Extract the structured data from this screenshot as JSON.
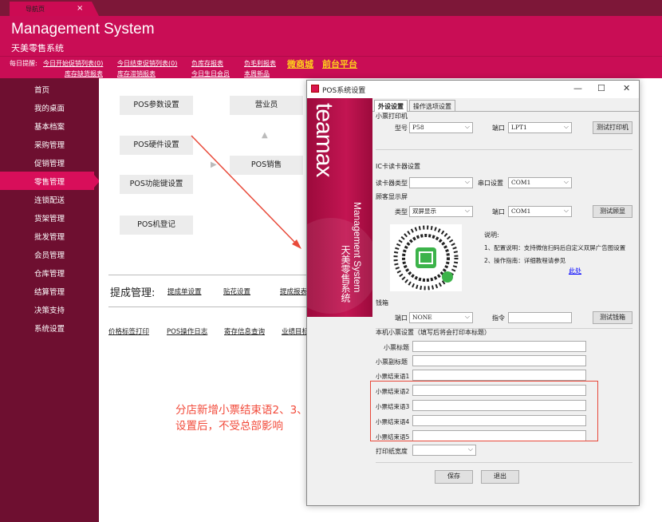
{
  "tab": {
    "label": "导航页",
    "close": "×"
  },
  "header": {
    "title": "Management System",
    "subtitle": "天美零售系统"
  },
  "reminder": {
    "prefix": "每日提醒:",
    "links": [
      "今日开始促销列表(0)",
      "库存缺货报表",
      "今日结束促销列表(0)",
      "库存滞销报表",
      "负库存报表",
      "今日生日会员",
      "负毛利报表",
      "本周新品"
    ],
    "highlights": [
      "微商城",
      "前台平台"
    ]
  },
  "sidebar": {
    "items": [
      "首页",
      "我的桌面",
      "基本档案",
      "采购管理",
      "促销管理",
      "零售管理",
      "连锁配送",
      "货架管理",
      "批发管理",
      "会员管理",
      "仓库管理",
      "结算管理",
      "决策支持",
      "系统设置"
    ],
    "active": 5
  },
  "flow": {
    "buttons": [
      "POS参数设置",
      "POS硬件设置",
      "POS功能键设置",
      "POS机登记",
      "营业员",
      "POS销售"
    ]
  },
  "tichen": {
    "title": "提成管理:",
    "links": [
      "提成单设置",
      "贴花设置",
      "提成报表"
    ]
  },
  "bottom_links": [
    "价格标签打印",
    "POS操作日志",
    "寄存信息查询",
    "业绩目标"
  ],
  "annotation": {
    "line1": "分店新增小票结束语2、3、4、5",
    "line2": "设置后，不受总部影响"
  },
  "dialog": {
    "title": "POS系统设置",
    "win_controls": {
      "min": "—",
      "max": "☐",
      "close": "✕"
    },
    "brand": {
      "logo": "teamax",
      "en": "Management System",
      "cn": "天美零售系统"
    },
    "tabs": [
      "外设设置",
      "操作选项设置"
    ],
    "printer": {
      "group": "小票打印机",
      "model_label": "型号",
      "model": "P58",
      "port_label": "端口",
      "port": "LPT1",
      "test": "测试打印机"
    },
    "ic": {
      "group": "IC卡读卡器设置",
      "type_label": "读卡器类型",
      "type": "",
      "serial_label": "串口设置",
      "serial": "COM1"
    },
    "display": {
      "group": "顾客显示屏",
      "type_label": "类型",
      "type": "双屏显示",
      "port_label": "端口",
      "port": "COM1",
      "test": "测试顾显",
      "note_title": "说明:",
      "note1": "1、配置说明：支持微信扫码后自定义双屏广告图设置",
      "note2": "2、操作指南：详细教程请参见",
      "note_link": "此处"
    },
    "cashbox": {
      "group": "钱箱",
      "port_label": "端口",
      "port": "NONE",
      "cmd_label": "指令",
      "test": "测试钱箱"
    },
    "receipt": {
      "group": "本机小票设置（填写后将会打印本标题）",
      "fields": [
        "小票标题",
        "小票副标题",
        "小票结束语1",
        "小票结束语2",
        "小票结束语3",
        "小票结束语4",
        "小票结束语5"
      ],
      "width_label": "打印纸宽度"
    },
    "save": "保存",
    "exit": "退出"
  }
}
